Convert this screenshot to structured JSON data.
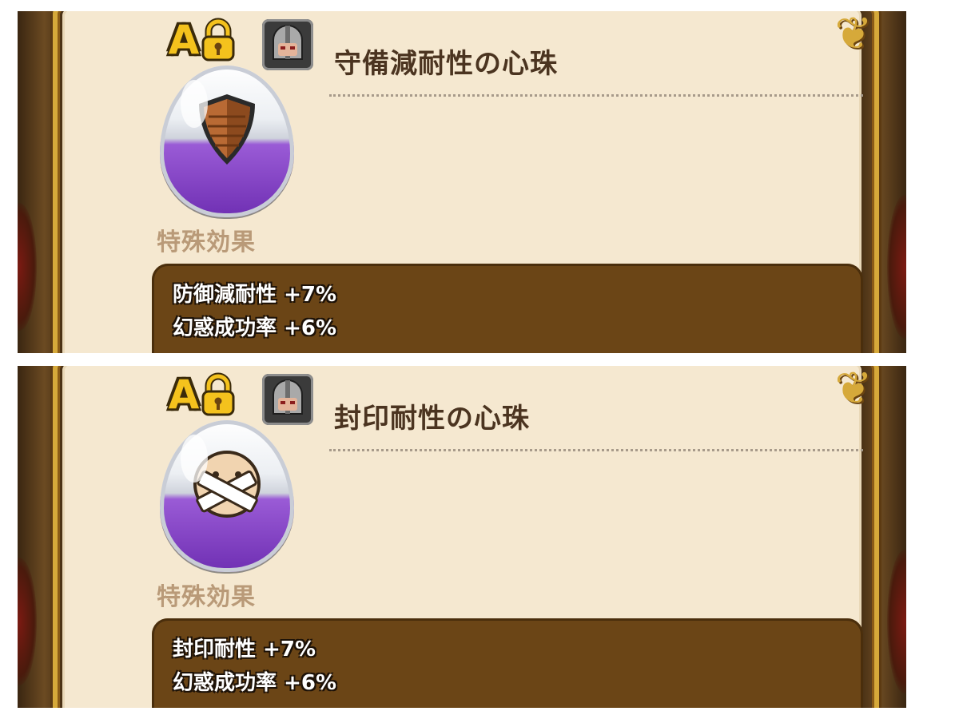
{
  "cards": [
    {
      "rank": "A",
      "title": "守備減耐性の心珠",
      "gem_icon": "shield-icon",
      "section_label": "特殊効果",
      "effects": [
        {
          "name": "防御減耐性",
          "value": "+7%"
        },
        {
          "name": "幻惑成功率",
          "value": "+6%"
        }
      ]
    },
    {
      "rank": "A",
      "title": "封印耐性の心珠",
      "gem_icon": "sealed-face-icon",
      "section_label": "特殊効果",
      "effects": [
        {
          "name": "封印耐性",
          "value": "+7%"
        },
        {
          "name": "幻惑成功率",
          "value": "+6%"
        }
      ]
    }
  ],
  "colors": {
    "gold": "#d6a93a",
    "card_bg": "#f5e8d0",
    "effects_bg": "#6b4516",
    "gem_purple": "#6f2fb3"
  }
}
